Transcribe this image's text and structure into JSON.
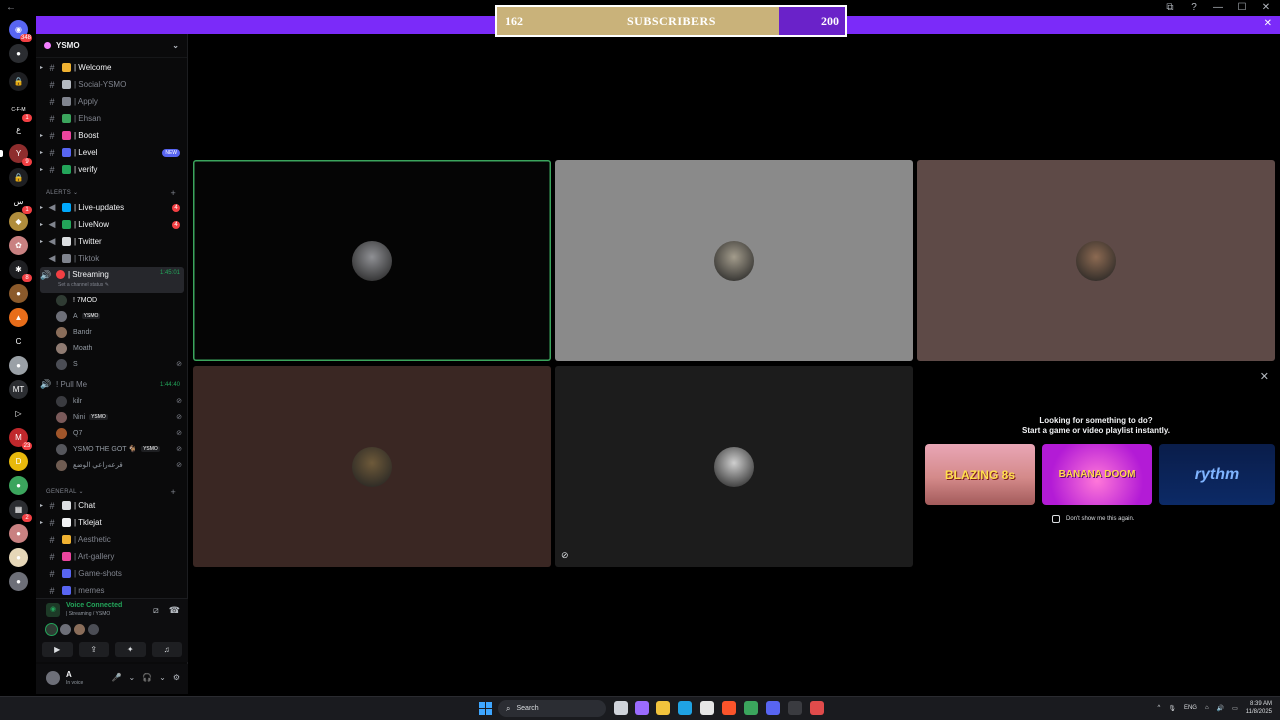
{
  "window": {
    "back_glyph": "←",
    "controls": [
      "⧉",
      "?",
      "—",
      "☐",
      "✕"
    ]
  },
  "notice": {
    "close_glyph": "✕"
  },
  "subscribers": {
    "current": "162",
    "label": "SUBSCRIBERS",
    "goal": "200",
    "progress_fraction": 0.81
  },
  "rail": {
    "items": [
      {
        "name": "direct-messages-icon",
        "glyph": "◉",
        "color": "#5865f2",
        "badge": "348"
      },
      {
        "name": "chat-icon",
        "glyph": "●",
        "color": "#2b2d31",
        "badge": ""
      },
      {
        "name": "server-lock-1",
        "glyph": "🔒",
        "color": "#1e1f22",
        "badge": ""
      },
      {
        "name": "server-cfm",
        "glyph": "C-F-M",
        "color": "#000000",
        "badge": "1"
      },
      {
        "name": "server-arabic",
        "glyph": "ع",
        "color": "#000000",
        "badge": ""
      },
      {
        "name": "server-ysmo",
        "glyph": "Y",
        "color": "#8e2d2d",
        "badge": "9"
      },
      {
        "name": "server-lock-2",
        "glyph": "🔒",
        "color": "#1e1f22",
        "badge": ""
      },
      {
        "name": "server-arabic-2",
        "glyph": "س",
        "color": "#000000",
        "badge": "1"
      },
      {
        "name": "server-gold",
        "glyph": "◆",
        "color": "#b08d3c",
        "badge": ""
      },
      {
        "name": "server-pink",
        "glyph": "✿",
        "color": "#c98181",
        "badge": ""
      },
      {
        "name": "server-spider",
        "glyph": "✱",
        "color": "#1e1f22",
        "badge": "8"
      },
      {
        "name": "server-animal",
        "glyph": "●",
        "color": "#8b5a2b",
        "badge": ""
      },
      {
        "name": "server-fire",
        "glyph": "▲",
        "color": "#e86d1a",
        "badge": ""
      },
      {
        "name": "server-c",
        "glyph": "C",
        "color": "#000000",
        "badge": ""
      },
      {
        "name": "server-photo",
        "glyph": "●",
        "color": "#9aa0a6",
        "badge": ""
      },
      {
        "name": "server-mt",
        "glyph": "MT",
        "color": "#2b2d31",
        "badge": ""
      },
      {
        "name": "server-play",
        "glyph": "▷",
        "color": "#000000",
        "badge": ""
      },
      {
        "name": "server-red",
        "glyph": "M",
        "color": "#c0282c",
        "badge": "23"
      },
      {
        "name": "server-yellow",
        "glyph": "D",
        "color": "#e8b90c",
        "badge": ""
      },
      {
        "name": "server-green",
        "glyph": "●",
        "color": "#3ba55d",
        "badge": ""
      },
      {
        "name": "server-folder",
        "glyph": "▦",
        "color": "#2b2d31",
        "badge": "2"
      },
      {
        "name": "server-girl",
        "glyph": "●",
        "color": "#c98181",
        "badge": ""
      },
      {
        "name": "server-cream",
        "glyph": "●",
        "color": "#e6d7b8",
        "badge": ""
      },
      {
        "name": "server-grey",
        "glyph": "●",
        "color": "#6d6f78",
        "badge": ""
      }
    ]
  },
  "server": {
    "name": "YSMO",
    "chevron": "⌄"
  },
  "channels_top": [
    {
      "label": "| Welcome",
      "bright": true,
      "color": "#f0b232"
    },
    {
      "label": "| Social-YSMO",
      "bright": false,
      "color": "#b5bac1"
    },
    {
      "label": "| Apply",
      "bright": false,
      "color": "#80848e"
    },
    {
      "label": "| Ehsan",
      "bright": false,
      "color": "#3ba55d"
    },
    {
      "label": "| Boost",
      "bright": true,
      "color": "#eb459e"
    },
    {
      "label": "| Level",
      "bright": true,
      "color": "#5865f2",
      "pill": "NEW"
    },
    {
      "label": "| verify",
      "bright": true,
      "color": "#23a55a"
    }
  ],
  "alerts_category": "ALERTS ⌄",
  "alerts_channels": [
    {
      "label": "| Live-updates",
      "bright": true,
      "color": "#00a8fc",
      "count": "4"
    },
    {
      "label": "| LiveNow",
      "bright": true,
      "color": "#23a55a",
      "count": "4"
    },
    {
      "label": "| Twitter",
      "bright": true,
      "color": "#dbdee1"
    },
    {
      "label": "| Tiktok",
      "bright": false,
      "color": "#80848e"
    }
  ],
  "streaming": {
    "label": "| Streaming",
    "time": "1:45:01",
    "status": "Set a channel status ✎",
    "members": [
      {
        "name": "! 7MOD",
        "avatar": "#2f3b33",
        "tag": "",
        "muted": false,
        "bright": true
      },
      {
        "name": "A",
        "avatar": "#6d6f78",
        "tag": "YSMO",
        "muted": false,
        "bright": false
      },
      {
        "name": "Bandr",
        "avatar": "#8a6d5a",
        "tag": "",
        "muted": false,
        "bright": false
      },
      {
        "name": "Moath",
        "avatar": "#8f7b72",
        "tag": "",
        "muted": false,
        "bright": false
      },
      {
        "name": "S",
        "avatar": "#4b4d55",
        "tag": "",
        "muted": true,
        "bright": false
      }
    ]
  },
  "pullme": {
    "label": "! Pull Me",
    "time": "1:44:40",
    "members": [
      {
        "name": "kilr",
        "avatar": "#3a3b40",
        "tag": "",
        "muted": true
      },
      {
        "name": "Nini",
        "avatar": "#7a5a5a",
        "tag": "YSMO",
        "muted": true
      },
      {
        "name": "Q7",
        "avatar": "#a0552a",
        "tag": "",
        "muted": true
      },
      {
        "name": "YSMO THE GOT 🐐",
        "avatar": "#55565c",
        "tag": "YSMO",
        "muted": true
      },
      {
        "name": "قرعه‌راعي الوضع",
        "avatar": "#6f5c52",
        "tag": "",
        "muted": true
      }
    ]
  },
  "general_category": "GENERAL ⌄",
  "general_channels": [
    {
      "label": "| Chat",
      "bright": true,
      "color": "#dbdee1"
    },
    {
      "label": "| Tklejat",
      "bright": true,
      "color": "#f2f3f5"
    },
    {
      "label": "| Aesthetic",
      "bright": false,
      "color": "#f0b232"
    },
    {
      "label": "| Art-gallery",
      "bright": false,
      "color": "#eb459e"
    },
    {
      "label": "| Game-shots",
      "bright": false,
      "color": "#5865f2"
    },
    {
      "label": "| memes",
      "bright": false,
      "color": "#5865f2"
    }
  ],
  "voice": {
    "connected_label": "Voice Connected",
    "channel_path": "| Streaming / YSMO",
    "buttons": [
      "camera-button",
      "screen-share-button",
      "activities-button",
      "soundboard-button"
    ],
    "button_glyphs": [
      "▶",
      "⇪",
      "✦",
      "♫"
    ]
  },
  "user": {
    "name": "A",
    "status": "In voice",
    "controls": [
      "🎤",
      "⌄",
      "🎧",
      "⌄",
      "⚙"
    ]
  },
  "tiles": [
    {
      "name": "tile-7mod",
      "bg": "#050505",
      "avatar": "#8f9094",
      "speaking": true,
      "muted": false
    },
    {
      "name": "tile-user-2",
      "bg": "#8a8a8a",
      "avatar": "#a39c8c",
      "speaking": false,
      "muted": false
    },
    {
      "name": "tile-user-3",
      "bg": "#5e4a47",
      "avatar": "#8c6a52",
      "speaking": false,
      "muted": false
    },
    {
      "name": "tile-user-4",
      "bg": "#3a2723",
      "avatar": "#6e5a3a",
      "speaking": false,
      "muted": false
    },
    {
      "name": "tile-user-5",
      "bg": "#1c1c1c",
      "avatar": "#cfcfcf",
      "speaking": false,
      "muted": true
    }
  ],
  "activity": {
    "line1": "Looking for something to do?",
    "line2": "Start a game or video playlist instantly.",
    "cards": [
      "BLAZING 8s",
      "BANANA DOOM",
      "rythm"
    ],
    "dont_show": "Don't show me this again.",
    "close_glyph": "✕"
  },
  "taskbar": {
    "search": "Search",
    "lang": "ENG",
    "time": "8:39 AM",
    "date": "11/8/2025",
    "apps": [
      {
        "name": "task-view-icon",
        "color": "#cfd3da"
      },
      {
        "name": "copilot-icon",
        "color": "#9b6bff"
      },
      {
        "name": "file-explorer-icon",
        "color": "#f2c33d"
      },
      {
        "name": "edge-icon",
        "color": "#1fa3e4"
      },
      {
        "name": "store-icon",
        "color": "#e6e6e6"
      },
      {
        "name": "brave-icon",
        "color": "#fb542b"
      },
      {
        "name": "vpn-icon",
        "color": "#3ba55d"
      },
      {
        "name": "discord-tb-icon",
        "color": "#5865f2"
      },
      {
        "name": "snip-icon",
        "color": "#3a3b40"
      },
      {
        "name": "screenrec-icon",
        "color": "#e04b4b"
      }
    ]
  }
}
